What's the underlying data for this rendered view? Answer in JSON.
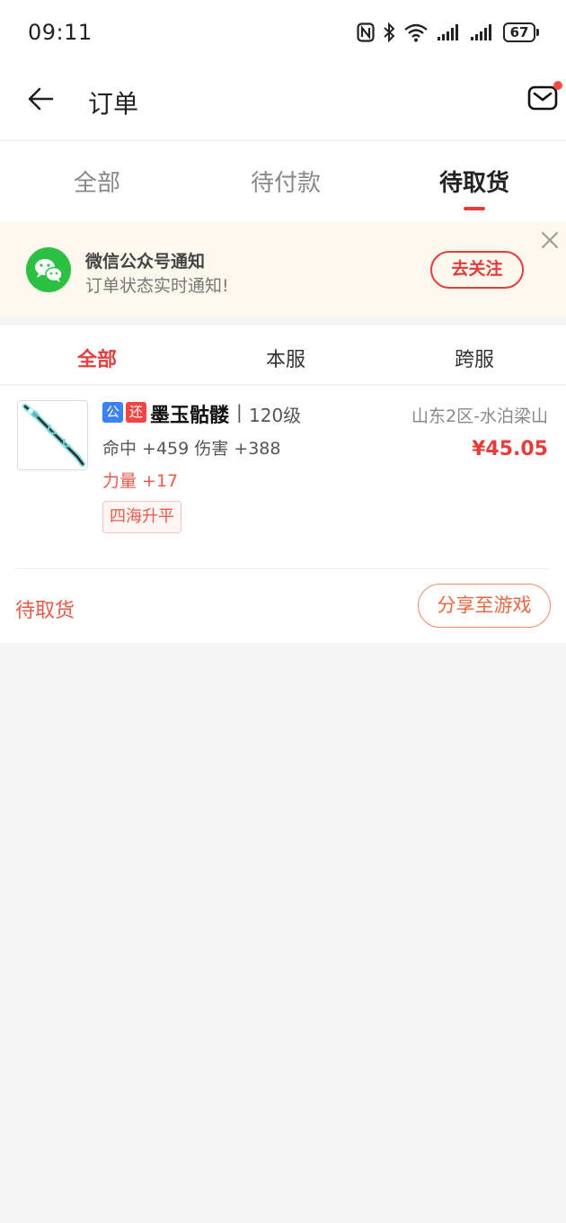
{
  "status_bar": {
    "time": "09:11",
    "battery": "67"
  },
  "header": {
    "title": "订单"
  },
  "main_tabs": [
    {
      "label": "全部",
      "active": false
    },
    {
      "label": "待付款",
      "active": false
    },
    {
      "label": "待取货",
      "active": true
    }
  ],
  "notice": {
    "title": "微信公众号通知",
    "subtitle": "订单状态实时通知!",
    "button": "去关注"
  },
  "sub_tabs": [
    {
      "label": "全部",
      "active": true
    },
    {
      "label": "本服",
      "active": false
    },
    {
      "label": "跨服",
      "active": false
    }
  ],
  "order": {
    "badge_public": "公",
    "badge_return": "还",
    "item_name": "墨玉骷髅",
    "separator": "|",
    "level": "120级",
    "server": "山东2区-水泊梁山",
    "attributes": "命中 +459 伤害 +388",
    "price": "¥45.05",
    "bonus": "力量 +17",
    "tag": "四海升平",
    "status": "待取货",
    "share_button": "分享至游戏"
  },
  "colors": {
    "accent_red": "#e53c3c",
    "wechat_green": "#2dc045",
    "notice_bg": "#fdf8ed",
    "badge_blue": "#3b82f6"
  }
}
